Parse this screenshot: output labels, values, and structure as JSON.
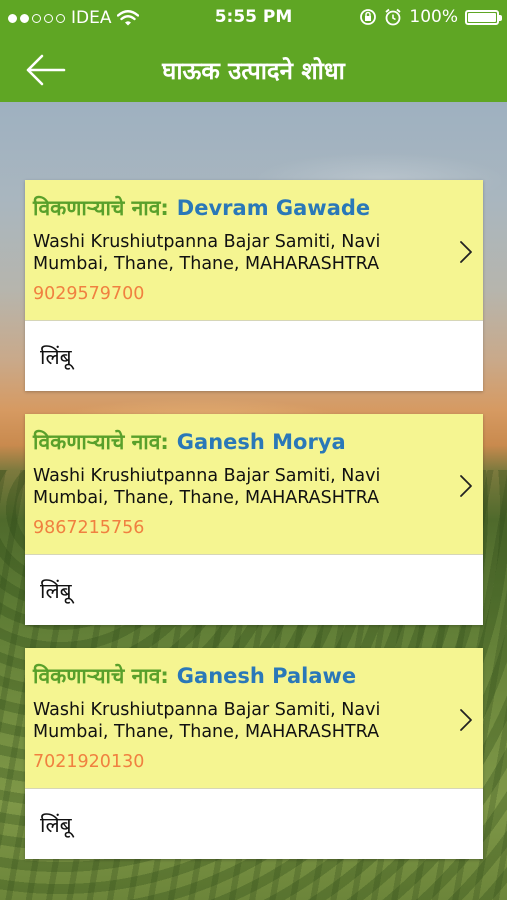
{
  "status_bar": {
    "carrier": "IDEA",
    "signal_dots_filled": 2,
    "signal_dots_total": 5,
    "time": "5:55 PM",
    "battery": "100%"
  },
  "nav": {
    "back_icon": "arrow-left-icon",
    "title": "घाऊक उत्पादने शोधा"
  },
  "listings": [
    {
      "seller_label": "विकणाऱ्याचे नाव:",
      "seller_name": "Devram Gawade",
      "address": "Washi Krushiutpanna Bajar Samiti, Navi Mumbai, Thane, Thane, MAHARASHTRA",
      "phone": "9029579700",
      "product": "लिंबू"
    },
    {
      "seller_label": "विकणाऱ्याचे नाव:",
      "seller_name": "Ganesh Morya",
      "address": "Washi Krushiutpanna Bajar Samiti, Navi Mumbai, Thane, Thane, MAHARASHTRA",
      "phone": "9867215756",
      "product": "लिंबू"
    },
    {
      "seller_label": "विकणाऱ्याचे नाव:",
      "seller_name": "Ganesh Palawe",
      "address": "Washi Krushiutpanna Bajar Samiti, Navi Mumbai, Thane, Thane, MAHARASHTRA",
      "phone": "7021920130",
      "product": "लिंबू"
    }
  ],
  "colors": {
    "header_green": "#5fa624",
    "card_head_yellow": "#f5f591",
    "seller_label_green": "#59a02b",
    "seller_name_blue": "#2a78b8",
    "phone_orange": "#f08040"
  }
}
